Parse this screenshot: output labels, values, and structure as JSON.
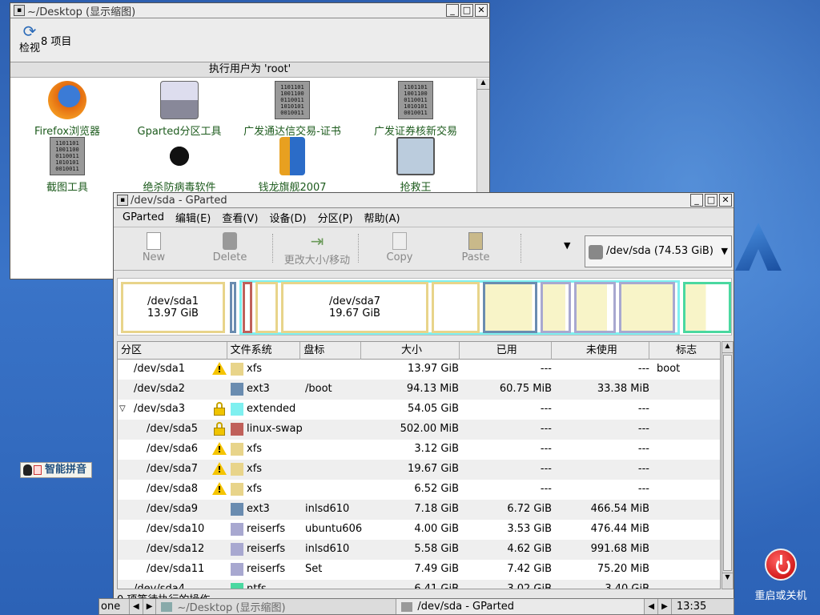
{
  "file_manager": {
    "title": "~/Desktop (显示缩图)",
    "refresh_label": "检视",
    "item_count": "8 项目",
    "root_banner": "执行用户为 'root'",
    "icons": [
      {
        "label": "Firefox浏览器",
        "icon": "firefox-icon"
      },
      {
        "label": "Gparted分区工具",
        "icon": "gparted-icon"
      },
      {
        "label": "广发通达信交易-证书版",
        "icon": "binary-file-icon"
      },
      {
        "label": "广发证券核新交易",
        "icon": "binary-file-icon"
      },
      {
        "label": "截图工具",
        "icon": "binary-file-icon"
      },
      {
        "label": "绝杀防病毒软件",
        "icon": "spider-icon"
      },
      {
        "label": "钱龙旗舰2007",
        "icon": "qianlong-icon"
      },
      {
        "label": "抢救王",
        "icon": "rescue-icon"
      }
    ],
    "binary_text": "1101101\n1001100\n0110011\n1010101\n0010011"
  },
  "gparted": {
    "title": "/dev/sda - GParted",
    "menu": [
      "GParted",
      "编辑(E)",
      "查看(V)",
      "设备(D)",
      "分区(P)",
      "帮助(A)"
    ],
    "toolbar": {
      "new": "New",
      "delete": "Delete",
      "resize": "更改大小/移动",
      "copy": "Copy",
      "paste": "Paste"
    },
    "device": "/dev/sda  (74.53 GiB)",
    "diskmap": {
      "sda1_name": "/dev/sda1",
      "sda1_size": "13.97 GiB",
      "sda7_name": "/dev/sda7",
      "sda7_size": "19.67 GiB"
    },
    "columns": [
      "分区",
      "文件系统",
      "盘标",
      "大小",
      "已用",
      "未使用",
      "标志"
    ],
    "rows": [
      {
        "part": "/dev/sda1",
        "indent": 0,
        "status": "warning",
        "fs": "xfs",
        "color": "#e8d48a",
        "label": "",
        "size": "13.97 GiB",
        "used": "---",
        "unused": "---",
        "flags": "boot"
      },
      {
        "part": "/dev/sda2",
        "indent": 0,
        "status": "",
        "fs": "ext3",
        "color": "#6a8cb0",
        "label": "/boot",
        "size": "94.13 MiB",
        "used": "60.75 MiB",
        "unused": "33.38 MiB",
        "flags": ""
      },
      {
        "part": "/dev/sda3",
        "indent": 0,
        "status": "lock",
        "fs": "extended",
        "color": "#7ff0f0",
        "label": "",
        "size": "54.05 GiB",
        "used": "---",
        "unused": "---",
        "flags": "",
        "expander": "▽"
      },
      {
        "part": "/dev/sda5",
        "indent": 1,
        "status": "lock",
        "fs": "linux-swap",
        "color": "#c0605a",
        "label": "",
        "size": "502.00 MiB",
        "used": "---",
        "unused": "---",
        "flags": ""
      },
      {
        "part": "/dev/sda6",
        "indent": 1,
        "status": "warning",
        "fs": "xfs",
        "color": "#e8d48a",
        "label": "",
        "size": "3.12 GiB",
        "used": "---",
        "unused": "---",
        "flags": ""
      },
      {
        "part": "/dev/sda7",
        "indent": 1,
        "status": "warning",
        "fs": "xfs",
        "color": "#e8d48a",
        "label": "",
        "size": "19.67 GiB",
        "used": "---",
        "unused": "---",
        "flags": ""
      },
      {
        "part": "/dev/sda8",
        "indent": 1,
        "status": "warning",
        "fs": "xfs",
        "color": "#e8d48a",
        "label": "",
        "size": "6.52 GiB",
        "used": "---",
        "unused": "---",
        "flags": ""
      },
      {
        "part": "/dev/sda9",
        "indent": 1,
        "status": "",
        "fs": "ext3",
        "color": "#6a8cb0",
        "label": "inlsd610",
        "size": "7.18 GiB",
        "used": "6.72 GiB",
        "unused": "466.54 MiB",
        "flags": ""
      },
      {
        "part": "/dev/sda10",
        "indent": 1,
        "status": "",
        "fs": "reiserfs",
        "color": "#a8a8d0",
        "label": "ubuntu606",
        "size": "4.00 GiB",
        "used": "3.53 GiB",
        "unused": "476.44 MiB",
        "flags": ""
      },
      {
        "part": "/dev/sda12",
        "indent": 1,
        "status": "",
        "fs": "reiserfs",
        "color": "#a8a8d0",
        "label": "inlsd610",
        "size": "5.58 GiB",
        "used": "4.62 GiB",
        "unused": "991.68 MiB",
        "flags": ""
      },
      {
        "part": "/dev/sda11",
        "indent": 1,
        "status": "",
        "fs": "reiserfs",
        "color": "#a8a8d0",
        "label": "Set",
        "size": "7.49 GiB",
        "used": "7.42 GiB",
        "unused": "75.20 MiB",
        "flags": ""
      },
      {
        "part": "/dev/sda4",
        "indent": 0,
        "status": "",
        "fs": "ntfs",
        "color": "#4ad8a0",
        "label": "",
        "size": "6.41 GiB",
        "used": "3.02 GiB",
        "unused": "3.40 GiB",
        "flags": ""
      }
    ],
    "status_text": "0 项等待执行的操作"
  },
  "taskbar": {
    "left_text": "one",
    "task1": "~/Desktop (显示缩图)",
    "task2": "/dev/sda - GParted",
    "clock": "13:35"
  },
  "ime": "智能拼音",
  "power_label": "重启或关机"
}
